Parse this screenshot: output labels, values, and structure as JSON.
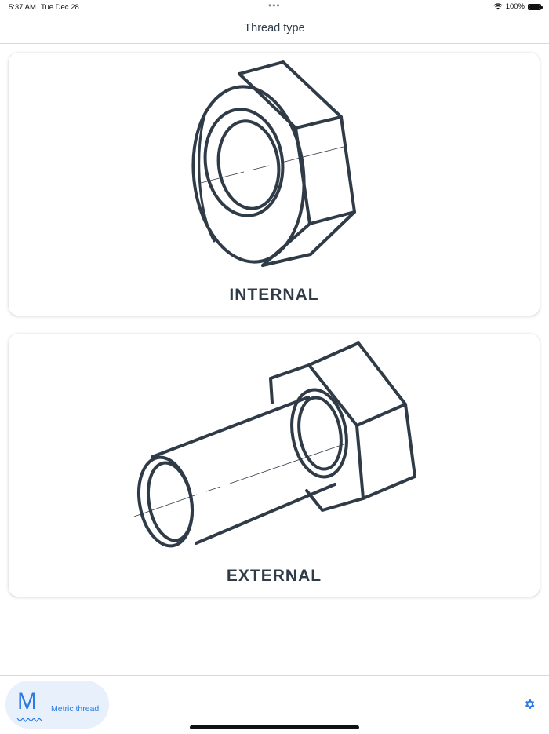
{
  "status_bar": {
    "time": "5:37 AM",
    "date": "Tue Dec 28",
    "dots": "•••",
    "battery_percent": "100%"
  },
  "nav": {
    "title": "Thread type"
  },
  "cards": {
    "internal": {
      "label": "INTERNAL",
      "icon": "hex-nut-illustration"
    },
    "external": {
      "label": "EXTERNAL",
      "icon": "hex-bolt-illustration"
    }
  },
  "bottom_bar": {
    "metric_letter": "M",
    "metric_label": "Metric thread",
    "settings_icon": "gear-icon"
  },
  "colors": {
    "accent": "#2c7be5",
    "line_art": "#2f3b47",
    "pill_background": "#e7f0fb"
  }
}
